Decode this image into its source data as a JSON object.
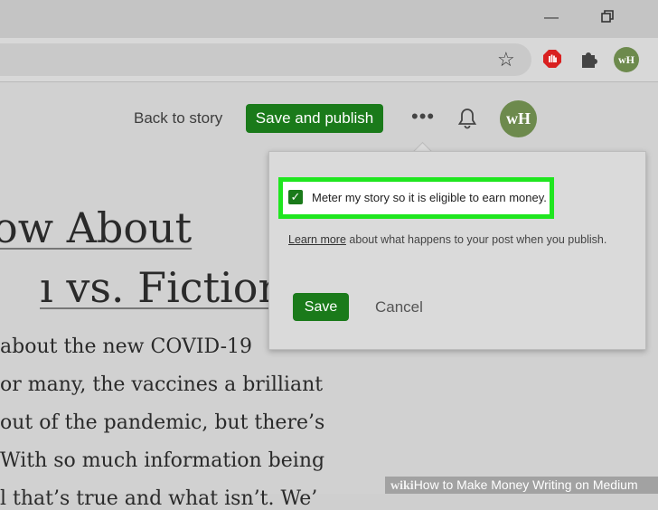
{
  "browser": {
    "avatar_initials": "wH"
  },
  "header": {
    "back_link": "Back to story",
    "publish_button": "Save and publish",
    "avatar_initials": "wH"
  },
  "article": {
    "title_lines": [
      "ow About",
      "ı vs. Fiction"
    ],
    "body_lines": [
      "about the new COVID-19",
      "or many, the vaccines a brilliant",
      "out of the pandemic, but there’s",
      "With so much information being",
      "l  that’s true and what isn’t. We’"
    ]
  },
  "popup": {
    "meter_label": "Meter my story so it is eligible to earn money.",
    "meter_checked": true,
    "learn_more_link": "Learn more",
    "learn_more_text": " about what happens to your post when you publish.",
    "save_button": "Save",
    "cancel_button": "Cancel"
  },
  "footer": {
    "brand": "wiki",
    "caption": "How to Make Money Writing on Medium"
  },
  "colors": {
    "accent_green": "#1a7a1a",
    "highlight": "#1fe61f",
    "avatar_bg": "#6d8a4d"
  }
}
